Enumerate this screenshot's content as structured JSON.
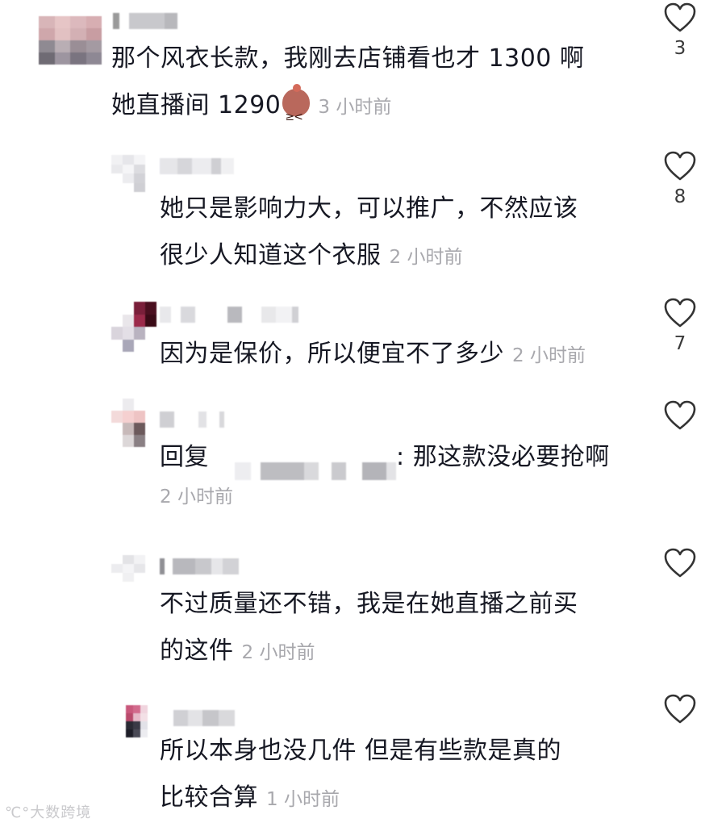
{
  "comments": [
    {
      "line1": "那个风衣长款，我刚去店铺看也才 1300 啊",
      "line2": "她直播间 1290",
      "emoji": "smiling-face-emoji",
      "time": "3 小时前",
      "likes": "3"
    },
    {
      "line1": "她只是影响力大，可以推广，不然应该",
      "line2": "很少人知道这个衣服",
      "time": "2 小时前",
      "likes": "8"
    },
    {
      "line1": "因为是保价，所以便宜不了多少",
      "time": "2 小时前",
      "likes": "7"
    },
    {
      "reply_prefix": "回复",
      "reply_suffix": ": 那这款没必要抢啊",
      "time": "2 小时前",
      "likes": ""
    },
    {
      "line1": "不过质量还不错，我是在她直播之前买",
      "line2": "的这件",
      "time": "2 小时前",
      "likes": ""
    },
    {
      "line1": "所以本身也没几件 但是有些款是真的",
      "line2": "比较合算",
      "time": "1 小时前",
      "likes": ""
    }
  ],
  "watermark": "大数跨境",
  "icons": {
    "like": "heart-outline-icon"
  },
  "colors": {
    "text": "#161823",
    "meta": "#a8a8ad",
    "icon": "#333333"
  }
}
